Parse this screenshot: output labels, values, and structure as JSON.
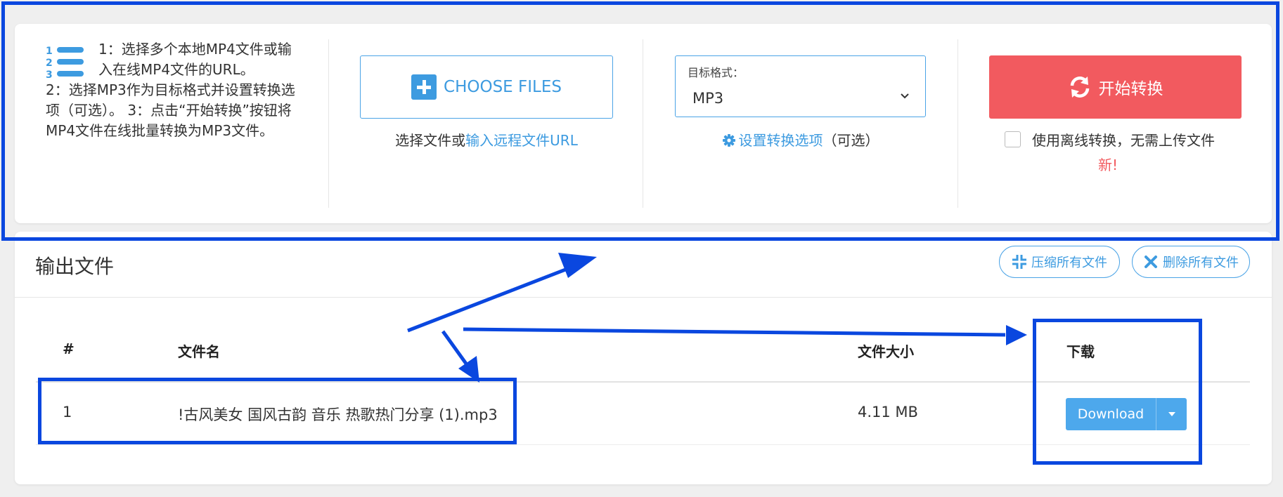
{
  "steps": {
    "first": "1：选择多个本地MP4文件或输入在线MP4文件的URL。",
    "rest": "2：选择MP3作为目标格式并设置转换选项（可选）。 3：点击“开始转换”按钮将MP4文件在线批量转换为MP3文件。"
  },
  "upload": {
    "choose_label": "CHOOSE FILES",
    "sub_text": "选择文件或",
    "sub_link": "输入远程文件URL"
  },
  "format": {
    "label": "目标格式：",
    "value": "MP3",
    "settings_link": "设置转换选项",
    "settings_suffix": "（可选）"
  },
  "convert": {
    "start_label": "开始转换",
    "offline_label": "使用离线转换，无需上传文件",
    "new_tag": "新!"
  },
  "output": {
    "title": "输出文件",
    "compress_all": "压缩所有文件",
    "delete_all": "删除所有文件",
    "columns": [
      "#",
      "文件名",
      "文件大小",
      "下载"
    ],
    "rows": [
      {
        "index": "1",
        "name": "!古风美女 国风古韵 音乐 热歌热门分享 (1).mp3",
        "size": "4.11 MB",
        "download": "Download"
      }
    ]
  },
  "colors": {
    "accent": "#3d9be0",
    "start": "#f25a5f",
    "annotation": "#0a47df"
  }
}
